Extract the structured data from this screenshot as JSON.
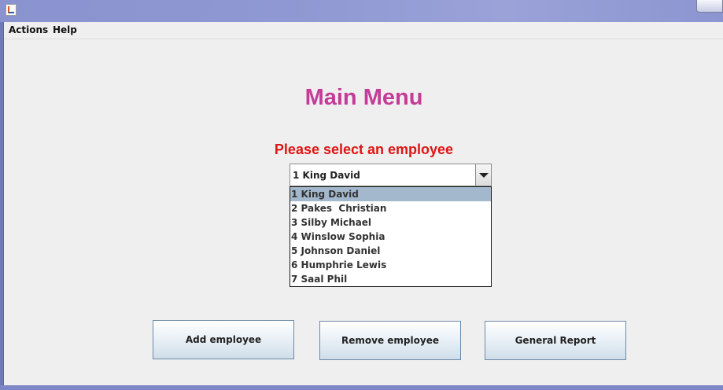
{
  "window": {
    "title": "",
    "app_icon": "java-cup-icon",
    "controls_icon": "window-close-icon"
  },
  "menubar": {
    "items": [
      {
        "label": "Actions"
      },
      {
        "label": "Help"
      }
    ]
  },
  "main": {
    "title": "Main Menu",
    "title_color": "#c43b98",
    "select_label": "Please select an employee",
    "select_label_color": "#e01414",
    "combo": {
      "selected": "1 King David",
      "options": [
        "1 King David",
        "2 Pakes  Christian",
        "3 Silby Michael",
        "4 Winslow Sophia",
        "5 Johnson Daniel",
        "6 Humphrie Lewis",
        "7 Saal Phil"
      ],
      "highlight_color": "#a3b8cc"
    },
    "buttons": {
      "add": "Add employee",
      "remove": "Remove employee",
      "report": "General Report"
    }
  }
}
